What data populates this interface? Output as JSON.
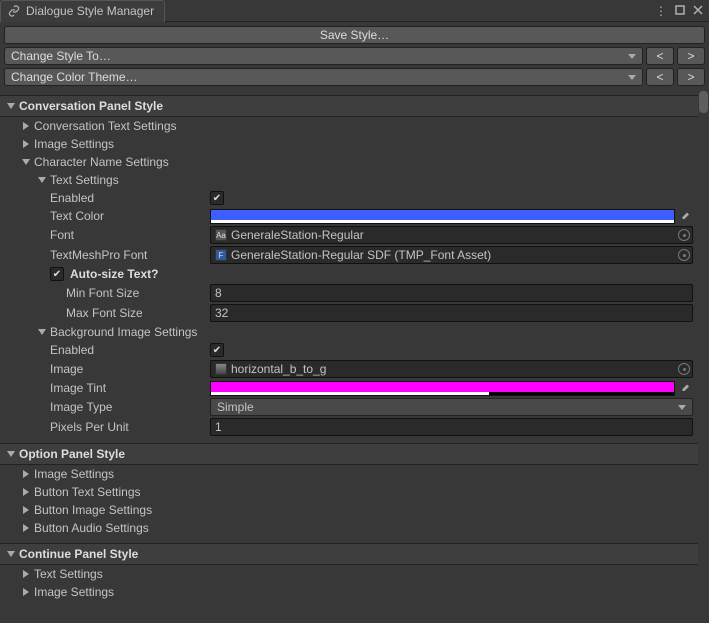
{
  "panel": {
    "title": "Dialogue Style Manager"
  },
  "topbar": {
    "save": "Save Style…",
    "changeStyle": "Change Style To…",
    "changeColor": "Change Color Theme…",
    "prev": "<",
    "next": ">"
  },
  "conversation": {
    "title": "Conversation Panel Style",
    "textSettings": "Conversation Text Settings",
    "imageSettings": "Image Settings",
    "charName": {
      "title": "Character Name Settings",
      "textSettings": {
        "title": "Text Settings",
        "enabled": {
          "label": "Enabled",
          "value": true
        },
        "textColor": {
          "label": "Text Color",
          "value": "#3f5eff",
          "alpha": 1.0
        },
        "font": {
          "label": "Font",
          "value": "GeneraleStation-Regular",
          "iconLabel": "Aa"
        },
        "tmpFont": {
          "label": "TextMeshPro Font",
          "value": "GeneraleStation-Regular SDF (TMP_Font Asset)",
          "iconLabel": "F"
        },
        "autoSize": {
          "label": "Auto-size Text?",
          "value": true
        },
        "minFontSize": {
          "label": "Min Font Size",
          "value": "8"
        },
        "maxFontSize": {
          "label": "Max Font Size",
          "value": "32"
        }
      },
      "bgImage": {
        "title": "Background Image Settings",
        "enabled": {
          "label": "Enabled",
          "value": true
        },
        "image": {
          "label": "Image",
          "value": "horizontal_b_to_g"
        },
        "tint": {
          "label": "Image Tint",
          "value": "#ff00ff",
          "alpha": 0.6
        },
        "imageType": {
          "label": "Image Type",
          "value": "Simple"
        },
        "pixelsPerUnit": {
          "label": "Pixels Per Unit",
          "value": "1"
        }
      }
    }
  },
  "option": {
    "title": "Option Panel Style",
    "imageSettings": "Image Settings",
    "buttonTextSettings": "Button Text Settings",
    "buttonImageSettings": "Button Image Settings",
    "buttonAudioSettings": "Button Audio Settings"
  },
  "continue": {
    "title": "Continue Panel Style",
    "textSettings": "Text Settings",
    "imageSettings": "Image Settings"
  }
}
